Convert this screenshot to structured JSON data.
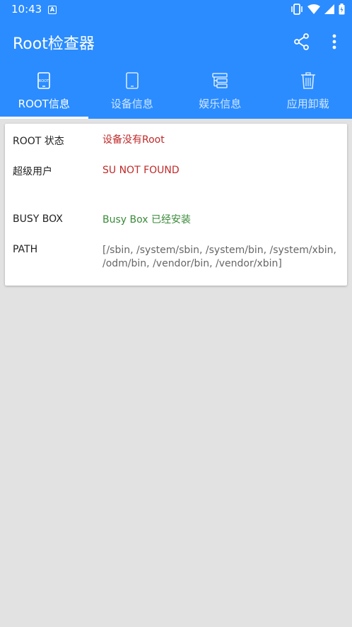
{
  "status_bar": {
    "time": "10:43",
    "badge": "A"
  },
  "toolbar": {
    "title": "Root检查器",
    "share_icon": "share-icon",
    "more_icon": "more-vert-icon"
  },
  "tabs": [
    {
      "label": "ROOT信息",
      "icon": "root-phone-icon",
      "active": true
    },
    {
      "label": "设备信息",
      "icon": "phone-icon",
      "active": false
    },
    {
      "label": "娱乐信息",
      "icon": "list-icon",
      "active": false
    },
    {
      "label": "应用卸载",
      "icon": "trash-icon",
      "active": false
    }
  ],
  "info": {
    "root_status": {
      "label": "ROOT 状态",
      "value": "设备没有Root"
    },
    "superuser": {
      "label": "超级用户",
      "value": "SU NOT FOUND"
    },
    "busybox": {
      "label": "BUSY BOX",
      "value": "Busy Box 已经安装"
    },
    "path": {
      "label": "PATH",
      "value": "[/sbin, /system/sbin, /system/bin, /system/xbin, /odm/bin, /vendor/bin, /vendor/xbin]"
    }
  },
  "colors": {
    "primary": "#2b8cff",
    "negative": "#c02a2a",
    "positive": "#3a8a3a",
    "background": "#e2e2e2"
  }
}
